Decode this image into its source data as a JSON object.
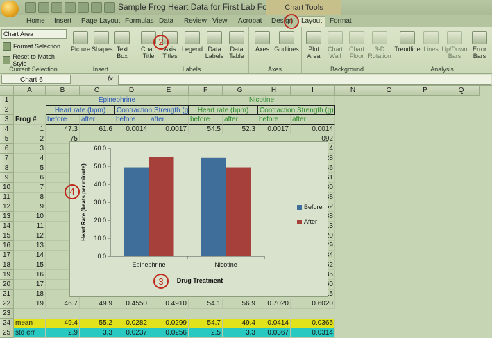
{
  "window": {
    "title": "Sample Frog Heart Data for First Lab For Student...",
    "context_title": "Chart Tools"
  },
  "tabs": [
    "Home",
    "Insert",
    "Page Layout",
    "Formulas",
    "Data",
    "Review",
    "View",
    "Acrobat",
    "Design",
    "Layout",
    "Format"
  ],
  "active_tab": "Layout",
  "ribbon": {
    "current_selection": {
      "dropdown": "Chart Area",
      "format_selection": "Format Selection",
      "reset": "Reset to Match Style",
      "label": "Current Selection"
    },
    "insert": {
      "picture": "Picture",
      "shapes": "Shapes",
      "textbox_1": "Text",
      "textbox_2": "Box",
      "label": "Insert"
    },
    "labels": {
      "chart_title_1": "Chart",
      "chart_title_2": "Title",
      "axis_titles_1": "Axis",
      "axis_titles_2": "Titles",
      "legend_1": "Legend",
      "data_labels_1": "Data",
      "data_labels_2": "Labels",
      "data_table_1": "Data",
      "data_table_2": "Table",
      "label": "Labels"
    },
    "axes": {
      "axes": "Axes",
      "gridlines": "Gridlines",
      "label": "Axes"
    },
    "background": {
      "plot_area_1": "Plot",
      "plot_area_2": "Area",
      "chart_wall_1": "Chart",
      "chart_wall_2": "Wall",
      "chart_floor_1": "Chart",
      "chart_floor_2": "Floor",
      "rotation_1": "3-D",
      "rotation_2": "Rotation",
      "label": "Background"
    },
    "analysis": {
      "trendline": "Trendline",
      "lines": "Lines",
      "updown_1": "Up/Down",
      "updown_2": "Bars",
      "error_1": "Error",
      "error_2": "Bars",
      "label": "Analysis"
    }
  },
  "formula_bar": {
    "name_box": "Chart 6",
    "fx": "fx"
  },
  "columns": [
    "A",
    "B",
    "C",
    "D",
    "E",
    "F",
    "G",
    "H",
    "I",
    "N",
    "O",
    "P",
    "Q"
  ],
  "rows": [
    "1",
    "2",
    "3",
    "4",
    "5",
    "6",
    "7",
    "8",
    "9",
    "10",
    "11",
    "12",
    "13",
    "14",
    "15",
    "16",
    "17",
    "18",
    "19",
    "20",
    "21",
    "22",
    "23",
    "24",
    "25"
  ],
  "table": {
    "group_epinephrine": "Epinephrine",
    "group_nicotine": "Nicotine",
    "hr_bpm": "Heart rate (bpm)",
    "contraction": "Contraction Strength (g)",
    "frog": "Frog #",
    "before": "before",
    "after": "after",
    "row4": [
      "1",
      "47.3",
      "61.6",
      "0.0014",
      "0.0017",
      "54.5",
      "52.3",
      "0.0017",
      "0.0014"
    ],
    "row5_a": "2",
    "row6_a": "3",
    "row7_a": "4",
    "row8_a": "5",
    "row9_a": "6",
    "row10_a": "7",
    "row11_a": "8",
    "row12_a": "9",
    "row13_a": "10",
    "row14_a": "11",
    "row15_a": "12",
    "row16_a": "13",
    "row17_a": "14",
    "row18_a": "15",
    "row19_a": "16",
    "row20_a": "17",
    "row21_a": "18",
    "row22": [
      "19",
      "46.7",
      "49.9",
      "0.4550",
      "0.4910",
      "54.1",
      "56.9",
      "0.7020",
      "0.6020"
    ],
    "right_partial": {
      "r5": "092",
      "r6": "014",
      "r7": "028",
      "r8": "046",
      "r9": "061",
      "r10": "030",
      "r11": "088",
      "r12": "052",
      "r13": "038",
      "r14": "013",
      "r15": "020",
      "r16": "129",
      "r17": "134",
      "r18": "052",
      "r19": "035",
      "r20": "060",
      "r21": "015"
    },
    "left_partial": {
      "r5": "75",
      "r6": "5",
      "r7": "7",
      "r8": "5",
      "r9": "4",
      "r10": "4",
      "r12": "3",
      "r13": "2",
      "r14": "5",
      "r15": "4",
      "r16": "5",
      "r17": "4",
      "r18": "4",
      "r19": "4",
      "r20": "4",
      "r21": "2"
    },
    "mean": [
      "mean",
      "49.4",
      "55.2",
      "0.0282",
      "0.0299",
      "54.7",
      "49.4",
      "0.0414",
      "0.0365"
    ],
    "stderr": [
      "std err",
      "2.9",
      "3.3",
      "0.0237",
      "0.0256",
      "2.5",
      "3.3",
      "0.0367",
      "0.0314"
    ]
  },
  "markers": {
    "m1": "1",
    "m2": "2",
    "m3": "3",
    "m4": "4"
  },
  "colors": {
    "before": "#3f6e9a",
    "after": "#a6403a",
    "mean_row": "#e1e21c",
    "stderr_row": "#28c9c0"
  },
  "chart_data": {
    "type": "bar",
    "categories": [
      "Epinephrine",
      "Nicotine"
    ],
    "series": [
      {
        "name": "Before",
        "values": [
          49.4,
          54.7
        ]
      },
      {
        "name": "After",
        "values": [
          55.2,
          49.4
        ]
      }
    ],
    "xlabel": "Drug Treatment",
    "ylabel": "Heart Rate (beats per minute)",
    "ylim": [
      0,
      60
    ],
    "yticks": [
      "0.0",
      "10.0",
      "20.0",
      "30.0",
      "40.0",
      "50.0",
      "60.0"
    ],
    "legend": "right",
    "grid": false
  }
}
